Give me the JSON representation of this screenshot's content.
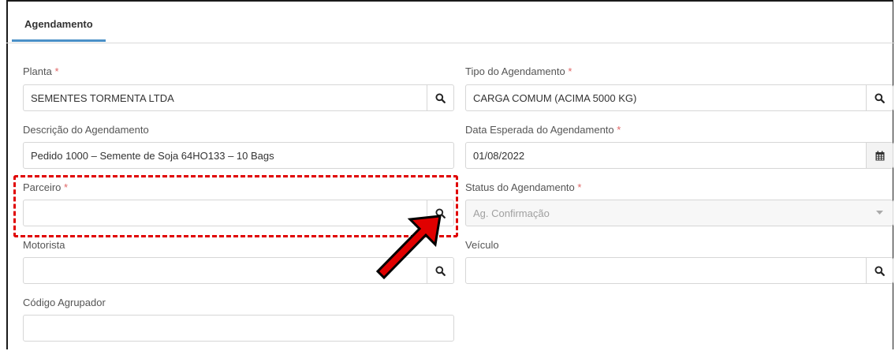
{
  "tabs": [
    {
      "label": "Agendamento"
    }
  ],
  "required_marker": "*",
  "fields": {
    "planta": {
      "label": "Planta",
      "value": "SEMENTES TORMENTA LTDA",
      "icon": "search-icon"
    },
    "tipo_agendamento": {
      "label": "Tipo do Agendamento",
      "value": "CARGA COMUM (ACIMA 5000 KG)",
      "icon": "search-icon"
    },
    "descricao": {
      "label": "Descrição do Agendamento",
      "value": "Pedido 1000 – Semente de Soja 64HO133 – 10 Bags"
    },
    "data_esperada": {
      "label": "Data Esperada do Agendamento",
      "value": "01/08/2022",
      "icon": "calendar-icon"
    },
    "parceiro": {
      "label": "Parceiro",
      "value": "",
      "icon": "search-icon"
    },
    "status": {
      "label": "Status do Agendamento",
      "value": "Ag. Confirmação",
      "icon": "caret-down-icon"
    },
    "motorista": {
      "label": "Motorista",
      "value": "",
      "icon": "search-icon"
    },
    "veiculo": {
      "label": "Veículo",
      "value": "",
      "icon": "search-icon"
    },
    "codigo_agrupador": {
      "label": "Código Agrupador",
      "value": ""
    }
  },
  "colors": {
    "accent": "#4a90c7",
    "required": "#e06666",
    "highlight": "#e00000"
  }
}
